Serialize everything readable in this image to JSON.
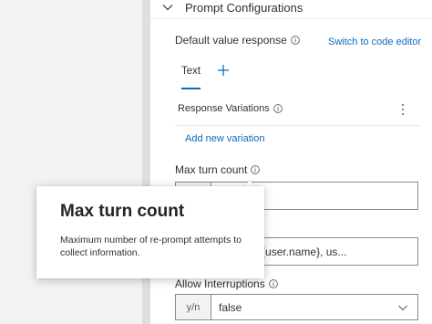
{
  "canvas": {
    "marker": "⁝"
  },
  "panel": {
    "section_title": "Prompt Configurations",
    "default_value": {
      "label": "Default value response",
      "switch_link": "Switch to code editor"
    },
    "tabs": [
      {
        "label": "Text",
        "active": true
      }
    ],
    "response_variations": {
      "label": "Response Variations",
      "add_link": "Add new variation"
    },
    "max_turn": {
      "label": "Max turn count",
      "value": ""
    },
    "default_value_field": {
      "value": "orld, Hello ${user.name}, us..."
    },
    "allow_interruptions": {
      "label": "Allow Interruptions",
      "prefix": "y/n",
      "value": "false"
    }
  },
  "tooltip": {
    "title": "Max turn count",
    "body": "Maximum number of re-prompt attempts to collect information."
  },
  "colors": {
    "accent": "#0f6cbd",
    "border": "#8a8886",
    "divider": "#e1dfdd"
  }
}
